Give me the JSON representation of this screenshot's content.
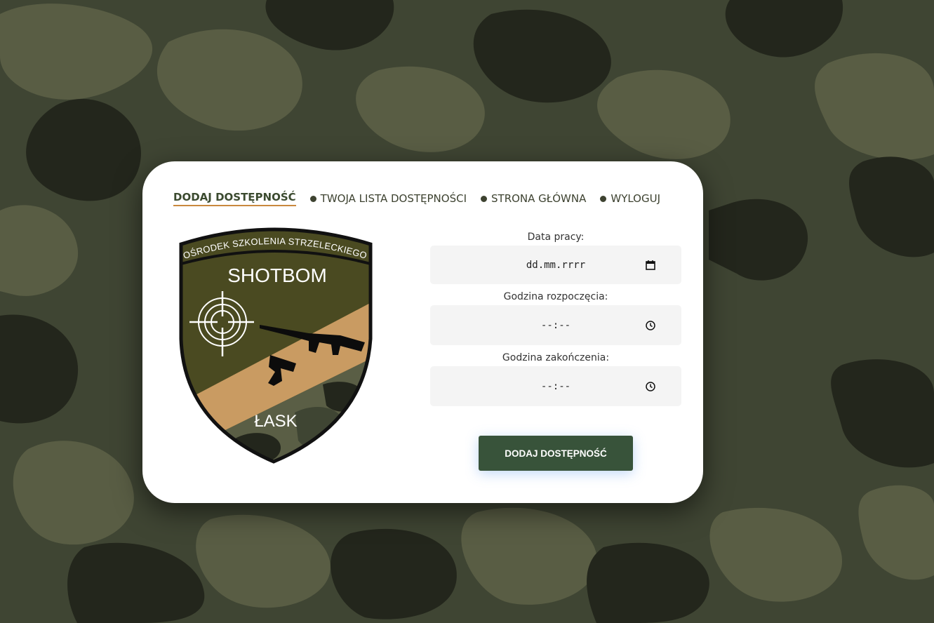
{
  "nav": {
    "active": "DODAJ DOSTĘPNOŚĆ",
    "item2": "TWOJA LISTA DOSTĘPNOŚCI",
    "item3": "STRONA GŁÓWNA",
    "item4": "WYLOGUJ"
  },
  "logo": {
    "arc_text": "OŚRODEK SZKOLENIA STRZELECKIEGO",
    "name": "SHOTBOM",
    "city": "ŁASK"
  },
  "form": {
    "date_label": "Data pracy:",
    "date_value": "dd.mm.rrrr",
    "start_label": "Godzina rozpoczęcia:",
    "start_value": "--:--",
    "end_label": "Godzina zakończenia:",
    "end_value": "--:--",
    "submit_label": "DODAJ DOSTĘPNOŚĆ"
  },
  "colors": {
    "camo_dark": "#23261c",
    "camo_mid": "#3f4533",
    "camo_light": "#5a5e45",
    "badge_olive": "#4a4a21",
    "badge_tan": "#c99b62",
    "button_green": "#38533a",
    "nav_underline": "#c9883e"
  }
}
